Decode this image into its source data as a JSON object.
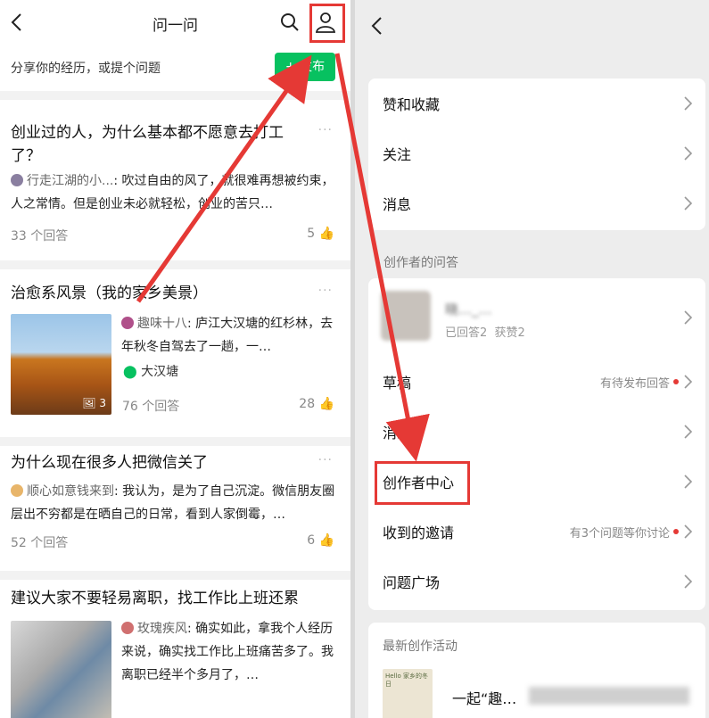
{
  "left": {
    "header": {
      "title": "问一问"
    },
    "share": {
      "prompt": "分享你的经历，或提个问题",
      "publish_label": "发布",
      "publish_plus": "+"
    },
    "questions": [
      {
        "title": "创业过的人，为什么基本都不愿意去打工了？",
        "author": "行走江湖的小...",
        "answer": "吹过自由的风了，就很难再想被约束，人之常情。但是创业未必就轻松，创业的苦只…",
        "count": "33 个回答",
        "likes": "5"
      },
      {
        "title": "治愈系风景（我的家乡美景）",
        "author": "趣味十八",
        "answer": "庐江大汉塘的红杉林，去年秋冬自驾去了一趟，一…",
        "location": "大汉塘",
        "photo_count": "3",
        "count": "76 个回答",
        "likes": "28"
      },
      {
        "title": "为什么现在很多人把微信关了",
        "author": "顺心如意钱来到",
        "answer": "我认为，是为了自己沉淀。微信朋友圈层出不穷都是在晒自己的日常，看到人家倒霉，…",
        "count": "52 个回答",
        "likes": "6"
      },
      {
        "title": "建议大家不要轻易离职，找工作比上班还累",
        "author": "玫瑰疾风",
        "answer": "确实如此，拿我个人经历来说，确实找工作比上班痛苦多了。我离职已经半个多月了，…",
        "count": "",
        "likes": ""
      }
    ]
  },
  "right": {
    "menu1": [
      {
        "label": "赞和收藏"
      },
      {
        "label": "关注"
      },
      {
        "label": "消息"
      }
    ],
    "section_creator": "创作者的问答",
    "profile": {
      "name": "晓…_…",
      "stats": "已回答2  获赞2"
    },
    "menu2": [
      {
        "label": "草稿",
        "hint": "有待发布回答",
        "dot": true
      },
      {
        "label": "消息",
        "hint": "",
        "dot": false
      },
      {
        "label": "创作者中心",
        "hint": "",
        "dot": false
      },
      {
        "label": "收到的邀请",
        "hint": "有3个问题等你讨论",
        "dot": true
      },
      {
        "label": "问题广场",
        "hint": "",
        "dot": false
      }
    ],
    "section_activity": "最新创作活动",
    "activity": {
      "title": "一起“趣…",
      "cover_text": "Hello 家乡的冬日"
    }
  },
  "colors": {
    "accent_green": "#07c160",
    "annotation_red": "#e53935"
  }
}
